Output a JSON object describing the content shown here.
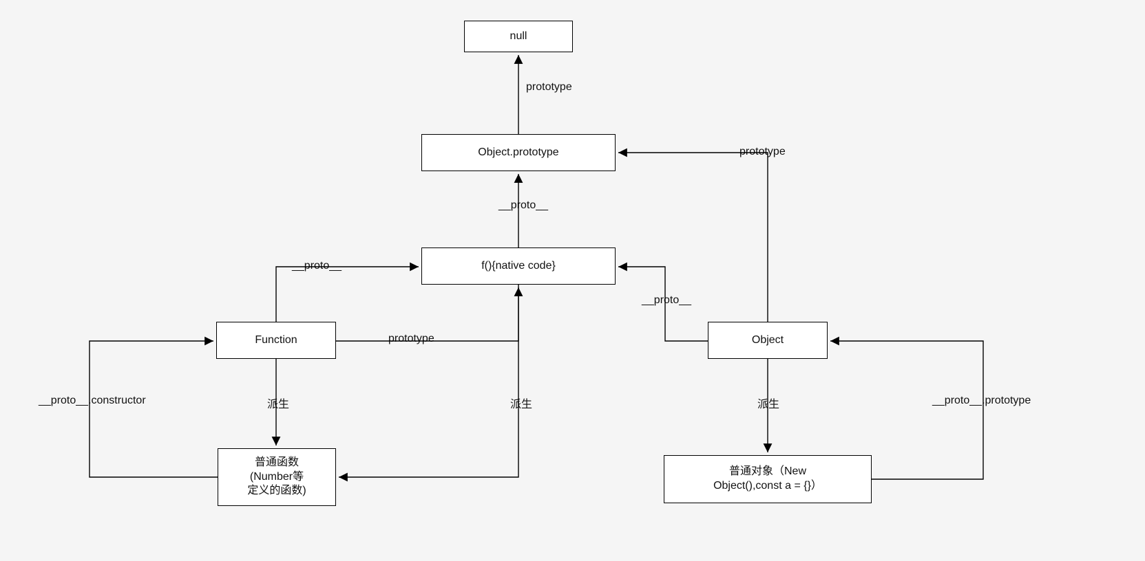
{
  "nodes": {
    "null": {
      "text": "null"
    },
    "obj_proto": {
      "text": "Object.prototype"
    },
    "native": {
      "text": "f(){native code}"
    },
    "function": {
      "text": "Function"
    },
    "object": {
      "text": "Object"
    },
    "plain_fn_l1": {
      "text": "普通函数"
    },
    "plain_fn_l2": {
      "text": "(Number等"
    },
    "plain_fn_l3": {
      "text": "定义的函数)"
    },
    "plain_obj_l1": {
      "text": "普通对象（New"
    },
    "plain_obj_l2": {
      "text": "Object(),const a = {}）"
    }
  },
  "labels": {
    "l_proto_top": "prototype",
    "l_proto_mid": "__proto__",
    "l_proto_left": "__proto__",
    "l_fn_proto": "prototype",
    "l_obj_proto_right": "prototype",
    "l_obj_proto_upleft": "__proto__",
    "l_derive_fn": "派生",
    "l_derive_native": "派生",
    "l_derive_obj": "派生",
    "l_proto_constr": "__proto__.constructor",
    "l_proto_proto": "__proto__.prototype"
  }
}
